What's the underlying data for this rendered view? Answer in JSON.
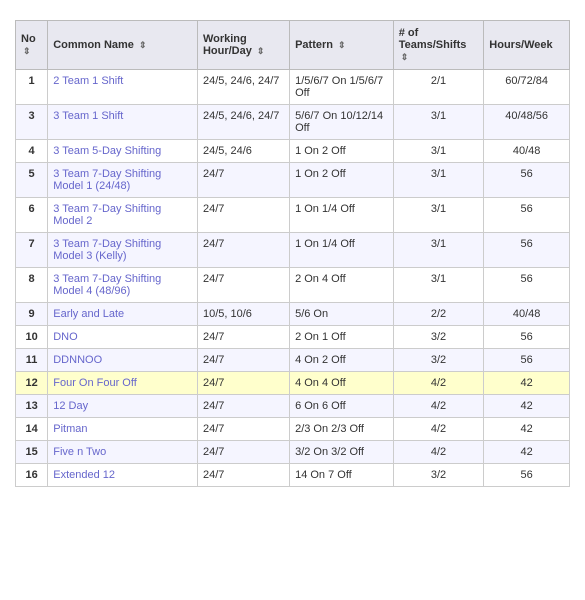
{
  "table": {
    "headers": [
      {
        "label": "No",
        "sort": true
      },
      {
        "label": "Common Name",
        "sort": true
      },
      {
        "label": "Working Hour/Day",
        "sort": true
      },
      {
        "label": "Pattern",
        "sort": true
      },
      {
        "label": "# of Teams/Shifts",
        "sort": true
      },
      {
        "label": "Hours/Week",
        "sort": false
      }
    ],
    "rows": [
      {
        "no": "1",
        "name": "2 Team 1 Shift",
        "working": "24/5, 24/6, 24/7",
        "pattern": "1/5/6/7 On 1/5/6/7 Off",
        "teams": "2/1",
        "hours": "60/72/84",
        "highlight": false
      },
      {
        "no": "3",
        "name": "3 Team 1 Shift",
        "working": "24/5, 24/6, 24/7",
        "pattern": "5/6/7 On 10/12/14 Off",
        "teams": "3/1",
        "hours": "40/48/56",
        "highlight": false
      },
      {
        "no": "4",
        "name": "3 Team 5-Day Shifting",
        "working": "24/5, 24/6",
        "pattern": "1 On 2 Off",
        "teams": "3/1",
        "hours": "40/48",
        "highlight": false
      },
      {
        "no": "5",
        "name": "3 Team 7-Day Shifting Model 1 (24/48)",
        "working": "24/7",
        "pattern": "1 On 2 Off",
        "teams": "3/1",
        "hours": "56",
        "highlight": false
      },
      {
        "no": "6",
        "name": "3 Team 7-Day Shifting Model 2",
        "working": "24/7",
        "pattern": "1 On 1/4 Off",
        "teams": "3/1",
        "hours": "56",
        "highlight": false
      },
      {
        "no": "7",
        "name": "3 Team 7-Day Shifting Model 3 (Kelly)",
        "working": "24/7",
        "pattern": "1 On 1/4 Off",
        "teams": "3/1",
        "hours": "56",
        "highlight": false
      },
      {
        "no": "8",
        "name": "3 Team 7-Day Shifting Model 4 (48/96)",
        "working": "24/7",
        "pattern": "2 On 4 Off",
        "teams": "3/1",
        "hours": "56",
        "highlight": false
      },
      {
        "no": "9",
        "name": "Early and Late",
        "working": "10/5, 10/6",
        "pattern": "5/6 On",
        "teams": "2/2",
        "hours": "40/48",
        "highlight": false
      },
      {
        "no": "10",
        "name": "DNO",
        "working": "24/7",
        "pattern": "2 On 1 Off",
        "teams": "3/2",
        "hours": "56",
        "highlight": false
      },
      {
        "no": "11",
        "name": "DDNNOO",
        "working": "24/7",
        "pattern": "4 On 2 Off",
        "teams": "3/2",
        "hours": "56",
        "highlight": false
      },
      {
        "no": "12",
        "name": "Four On Four Off",
        "working": "24/7",
        "pattern": "4 On 4 Off",
        "teams": "4/2",
        "hours": "42",
        "highlight": true
      },
      {
        "no": "13",
        "name": "12 Day",
        "working": "24/7",
        "pattern": "6 On 6 Off",
        "teams": "4/2",
        "hours": "42",
        "highlight": false
      },
      {
        "no": "14",
        "name": "Pitman",
        "working": "24/7",
        "pattern": "2/3 On 2/3 Off",
        "teams": "4/2",
        "hours": "42",
        "highlight": false
      },
      {
        "no": "15",
        "name": "Five n Two",
        "working": "24/7",
        "pattern": "3/2 On 3/2 Off",
        "teams": "4/2",
        "hours": "42",
        "highlight": false
      },
      {
        "no": "16",
        "name": "Extended 12",
        "working": "24/7",
        "pattern": "14 On 7 Off",
        "teams": "3/2",
        "hours": "56",
        "highlight": false
      }
    ]
  }
}
